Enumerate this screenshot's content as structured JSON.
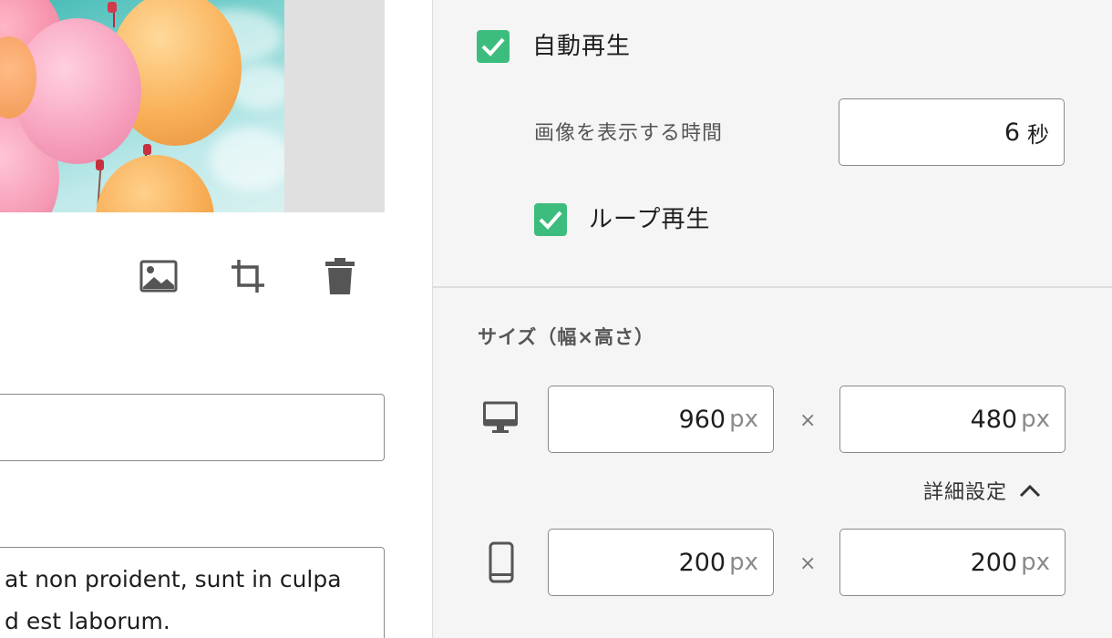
{
  "editor": {
    "caption_text_lines": [
      "at non proident, sunt in culpa",
      "d est laborum."
    ],
    "toolbar": {
      "replace_icon": "image-icon",
      "crop_icon": "crop-icon",
      "delete_icon": "trash-icon"
    }
  },
  "settings": {
    "autoplay": {
      "label": "自動再生",
      "checked": true
    },
    "display_time": {
      "label": "画像を表示する時間",
      "value": "6",
      "unit": "秒"
    },
    "loop": {
      "label": "ループ再生",
      "checked": true
    },
    "size": {
      "title": "サイズ（幅×高さ）",
      "separator": "×",
      "desktop": {
        "icon": "desktop-icon",
        "width": "960",
        "height": "480",
        "unit": "px"
      },
      "advanced_toggle": {
        "label": "詳細設定",
        "icon": "chevron-up-icon"
      },
      "mobile": {
        "icon": "mobile-icon",
        "width": "200",
        "height": "200",
        "unit": "px"
      }
    }
  },
  "colors": {
    "checkbox_green": "#3dbd7d",
    "panel_bg": "#f5f5f5",
    "border": "#8a8a8a"
  }
}
